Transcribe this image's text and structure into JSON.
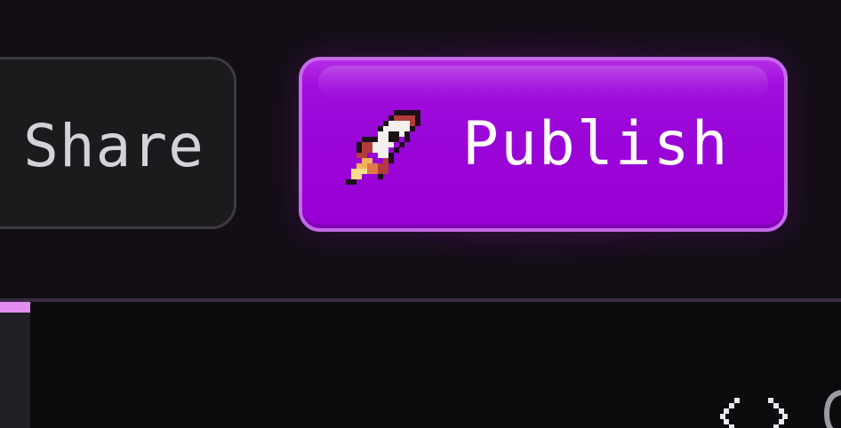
{
  "toolbar": {
    "share_label": "Share",
    "publish_label": "Publish"
  },
  "icons": {
    "publish_icon": "rocket-icon",
    "code_icon": "code-brackets-icon",
    "partial_icon": "partial-icon"
  },
  "colors": {
    "publish_bg": "#9b06d8",
    "publish_border": "#c56ae8",
    "share_bg": "#1b1a1c",
    "share_border": "#3d3a40",
    "accent": "#e38ef0"
  }
}
